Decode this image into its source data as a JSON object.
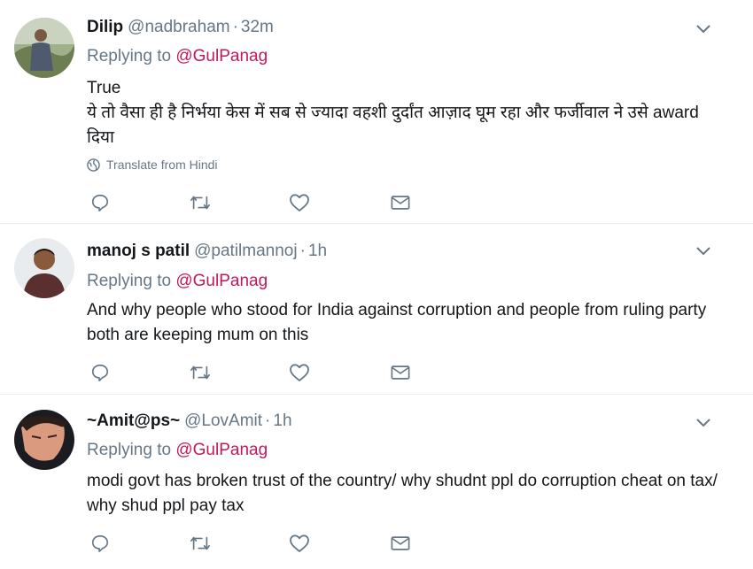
{
  "tweets": [
    {
      "name": "Dilip",
      "handle": "@nadbraham",
      "separator": "·",
      "time": "32m",
      "replying_prefix": "Replying to",
      "replying_mention": "@GulPanag",
      "text_lines": [
        "True",
        "ये तो वैसा ही है निर्भया केस में सब से ज्यादा वहशी दुर्दांत आज़ाद घूम रहा और फर्जीवाल ने उसे award दिया"
      ],
      "translate_label": "Translate from Hindi"
    },
    {
      "name": "manoj s patil",
      "handle": "@patilmannoj",
      "separator": "·",
      "time": "1h",
      "replying_prefix": "Replying to",
      "replying_mention": "@GulPanag",
      "text_lines": [
        "And why people who stood for India against corruption and people from ruling party both are keeping mum on this"
      ]
    },
    {
      "name": "~Amit@ps~",
      "handle": "@LovAmit",
      "separator": "·",
      "time": "1h",
      "replying_prefix": "Replying to",
      "replying_mention": "@GulPanag",
      "text_lines": [
        "modi govt has broken trust of the country/ why shudnt ppl do corruption cheat on tax/ why shud ppl pay tax"
      ]
    }
  ],
  "icons": {
    "reply": "reply-icon",
    "retweet": "retweet-icon",
    "like": "heart-icon",
    "message": "envelope-icon",
    "caret": "chevron-down-icon",
    "globe": "globe-icon"
  },
  "colors": {
    "text": "#14171a",
    "secondary": "#657786",
    "mention": "#c2185b",
    "divider": "#e6ecf0"
  }
}
